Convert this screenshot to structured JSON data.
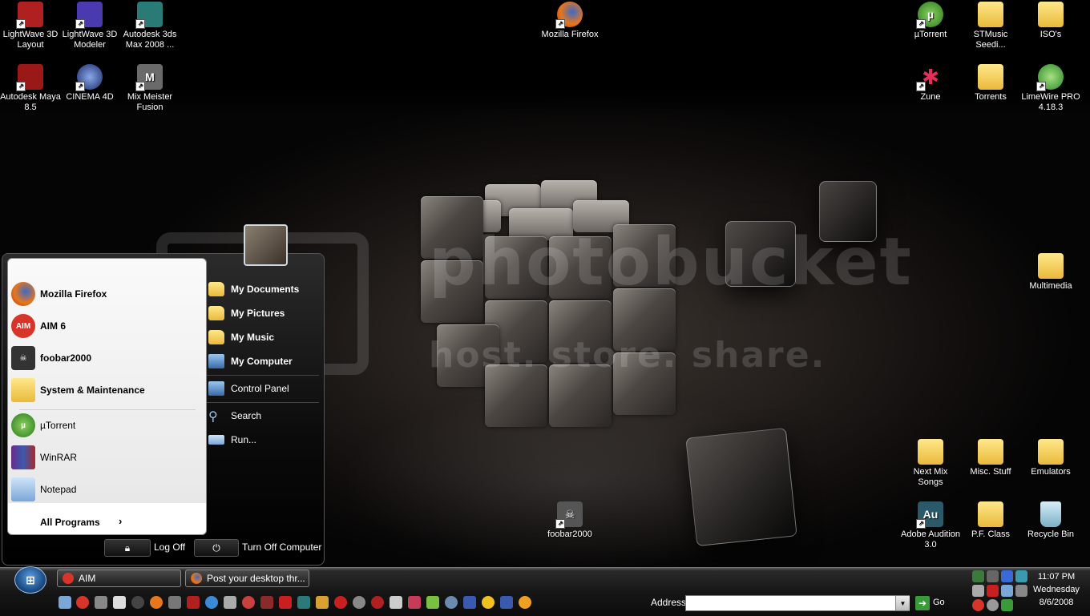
{
  "desktop_icons": {
    "lightwave_layout": "LightWave 3D Layout",
    "lightwave_modeler": "LightWave 3D Modeler",
    "max": "Autodesk 3ds Max 2008 ...",
    "maya": "Autodesk Maya 8.5",
    "cinema": "CINEMA 4D",
    "mixmeister": "Mix Meister Fusion",
    "firefox": "Mozilla Firefox",
    "utorrent": "µTorrent",
    "stmusic": "STMusic Seedi...",
    "isos": "ISO's",
    "zune": "Zune",
    "torrents": "Torrents",
    "limewire": "LimeWire PRO 4.18.3",
    "multimedia": "Multimedia",
    "nextmix": "Next Mix Songs",
    "misc": "Misc. Stuff",
    "emulators": "Emulators",
    "foobar": "foobar2000",
    "audition": "Adobe Audition 3.0",
    "pfclass": "P.F. Class",
    "recycle": "Recycle Bin",
    "audition_glyph": "Au"
  },
  "watermark": {
    "line1": "photobucket",
    "line2": "host. store. share."
  },
  "start_menu": {
    "pinned": [
      {
        "label": "Mozilla Firefox"
      },
      {
        "label": "AIM 6"
      },
      {
        "label": "foobar2000"
      },
      {
        "label": "System & Maintenance"
      }
    ],
    "recent": [
      {
        "label": "µTorrent"
      },
      {
        "label": "WinRAR"
      },
      {
        "label": "Notepad"
      }
    ],
    "all_programs": "All Programs",
    "places": [
      {
        "label": "My Documents"
      },
      {
        "label": "My Pictures"
      },
      {
        "label": "My Music"
      },
      {
        "label": "My Computer"
      },
      {
        "label": "Control Panel"
      },
      {
        "label": "Search"
      },
      {
        "label": "Run..."
      }
    ],
    "log_off": "Log Off",
    "turn_off": "Turn Off Computer",
    "aim_glyph": "AIM"
  },
  "taskbar": {
    "buttons": [
      {
        "label": "AIM"
      },
      {
        "label": "Post your desktop thr..."
      }
    ],
    "address_label": "Address",
    "address_value": "",
    "go_label": "Go",
    "clock": {
      "time": "11:07 PM",
      "day": "Wednesday",
      "date": "8/6/2008"
    }
  },
  "colors": {
    "folder": "#f0c850",
    "firefox": "#e8761c",
    "utorrent": "#4a9a2a",
    "aim": "#d8352a"
  }
}
